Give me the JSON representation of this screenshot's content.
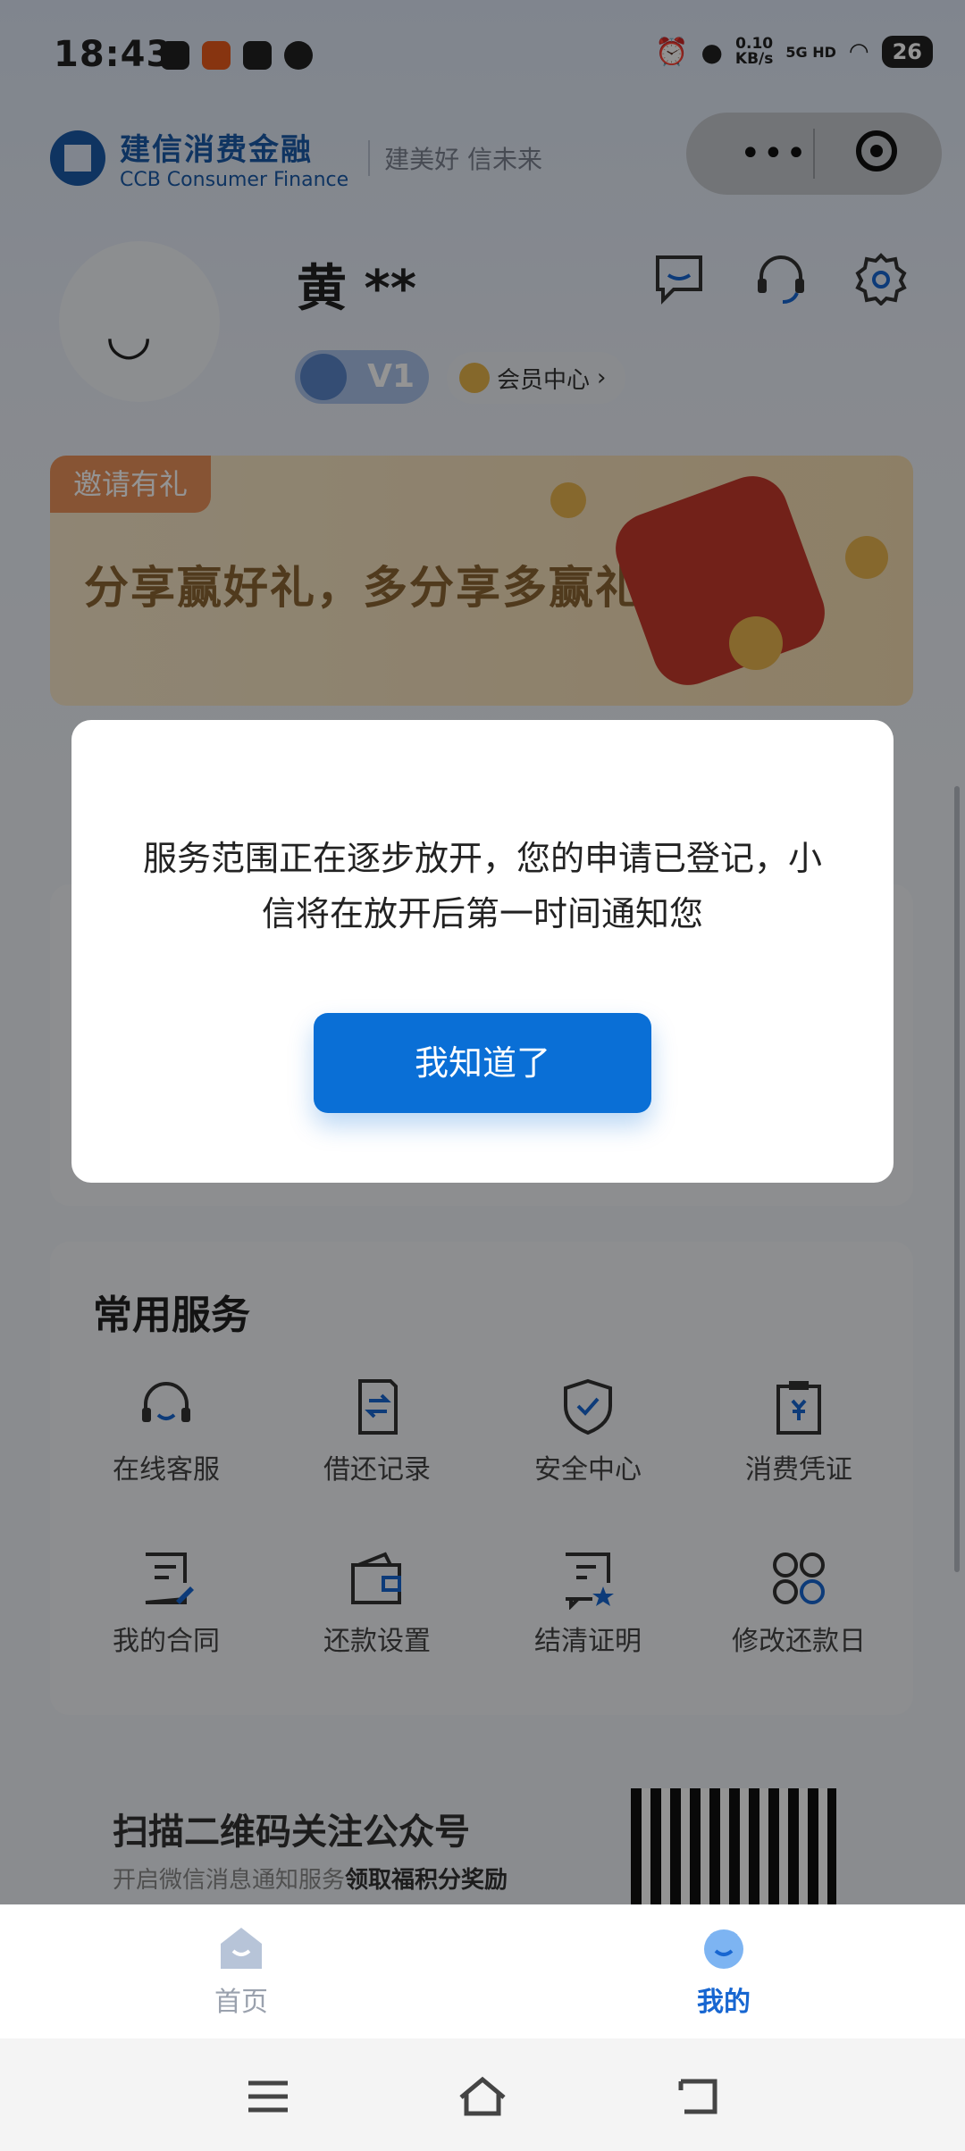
{
  "status_bar": {
    "time": "18:43",
    "net_speed_value": "0.10",
    "net_speed_unit": "KB/s",
    "network": "5G HD",
    "battery": "26"
  },
  "header": {
    "brand_cn": "建信消费金融",
    "brand_en": "CCB Consumer Finance",
    "slogan": "建美好 信未来"
  },
  "profile": {
    "name": "黄 **",
    "level": "V1",
    "member_center": "会员中心"
  },
  "banner": {
    "tag": "邀请有礼",
    "title": "分享赢好礼，多分享多赢礼"
  },
  "services": {
    "title": "常用服务",
    "items": [
      {
        "label": "在线客服",
        "icon": "headset-icon"
      },
      {
        "label": "借还记录",
        "icon": "record-icon"
      },
      {
        "label": "安全中心",
        "icon": "shield-icon"
      },
      {
        "label": "消费凭证",
        "icon": "voucher-icon"
      },
      {
        "label": "我的合同",
        "icon": "contract-icon"
      },
      {
        "label": "还款设置",
        "icon": "wallet-icon"
      },
      {
        "label": "结清证明",
        "icon": "certificate-icon"
      },
      {
        "label": "修改还款日",
        "icon": "grid-icon"
      }
    ]
  },
  "qr_card": {
    "title": "扫描二维码关注公众号",
    "subtitle_prefix": "开启微信消息通知服务",
    "subtitle_bold": "领取福积分奖励"
  },
  "modal": {
    "message": "服务范围正在逐步放开，您的申请已登记，小信将在放开后第一时间通知您",
    "button": "我知道了"
  },
  "tabbar": {
    "home": "首页",
    "mine": "我的"
  },
  "colors": {
    "primary": "#0a6fd6",
    "brand": "#1a5aa8",
    "active_tab": "#1766d1",
    "inactive_tab": "#9aa1ad"
  }
}
